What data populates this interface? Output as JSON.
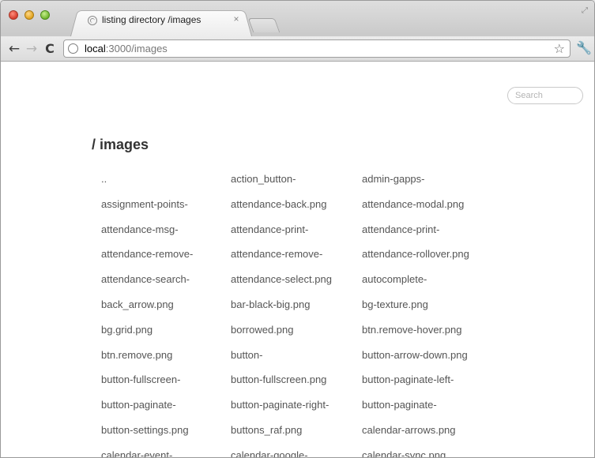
{
  "browser": {
    "tab_title": "listing directory /images",
    "tab_close": "×",
    "url_host": "local",
    "url_rest": ":3000/images",
    "icons": {
      "back": "back-arrow-icon",
      "forward": "forward-arrow-icon",
      "reload": "reload-icon",
      "star": "bookmark-star-icon",
      "wrench": "wrench-menu-icon",
      "favicon": "globe-icon"
    }
  },
  "page": {
    "search_placeholder": "Search",
    "heading": "/ images",
    "files": [
      "..",
      "action_button-",
      "admin-gapps-",
      "assignment-points-",
      "attendance-back.png",
      "attendance-modal.png",
      "attendance-msg-",
      "attendance-print-",
      "attendance-print-",
      "attendance-remove-",
      "attendance-remove-",
      "attendance-rollover.png",
      "attendance-search-",
      "attendance-select.png",
      "autocomplete-",
      "back_arrow.png",
      "bar-black-big.png",
      "bg-texture.png",
      "bg.grid.png",
      "borrowed.png",
      "btn.remove-hover.png",
      "btn.remove.png",
      "button-",
      "button-arrow-down.png",
      "button-fullscreen-",
      "button-fullscreen.png",
      "button-paginate-left-",
      "button-paginate-",
      "button-paginate-right-",
      "button-paginate-",
      "button-settings.png",
      "buttons_raf.png",
      "calendar-arrows.png",
      "calendar-event-",
      "calendar-google-",
      "calendar-sync.png"
    ]
  }
}
